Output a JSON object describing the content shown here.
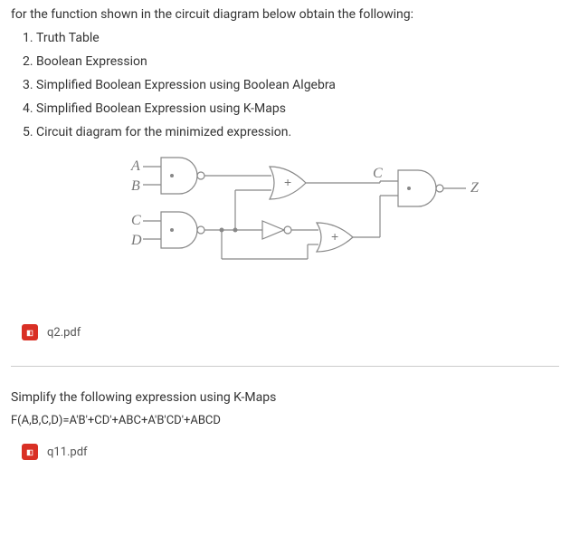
{
  "q1": {
    "intro": "for the function shown in the circuit diagram below obtain the following:",
    "tasks": [
      "Truth Table",
      "Boolean Expression",
      "Simplified Boolean Expression using Boolean Algebra",
      "Simplified Boolean Expression using K-Maps",
      "Circuit diagram for the minimized expression."
    ]
  },
  "circuit": {
    "labels": {
      "A": "A",
      "B": "B",
      "C": "C",
      "D": "D",
      "Cin": "C",
      "Z": "Z",
      "plus1": "+",
      "plus2": "+"
    }
  },
  "files": {
    "file1": "q2.pdf",
    "file2": "q11.pdf"
  },
  "q2": {
    "text": "Simplify the following expression using K-Maps",
    "equation": "F(A,B,C,D)=A'B'+CD'+ABC+A'B'CD'+ABCD"
  }
}
